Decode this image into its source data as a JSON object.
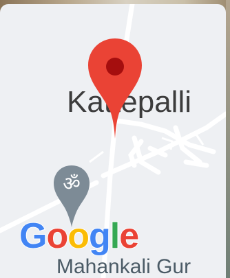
{
  "map": {
    "place_label": "Kattepalli",
    "poi_label": "Mahankali Gur",
    "temple_icon": "om-icon",
    "pin_icon": "location-pin-icon"
  },
  "logo": {
    "letters": [
      "G",
      "o",
      "o",
      "g",
      "l",
      "e"
    ],
    "colors": [
      "#4285F4",
      "#EA4335",
      "#FBBC05",
      "#4285F4",
      "#34A853",
      "#EA4335"
    ]
  },
  "colors": {
    "map_background": "#eef0f3",
    "road": "#ffffff",
    "pin": "#ea4335",
    "pin_dot": "#a50e0e",
    "temple_pin": "#7d8b96"
  }
}
